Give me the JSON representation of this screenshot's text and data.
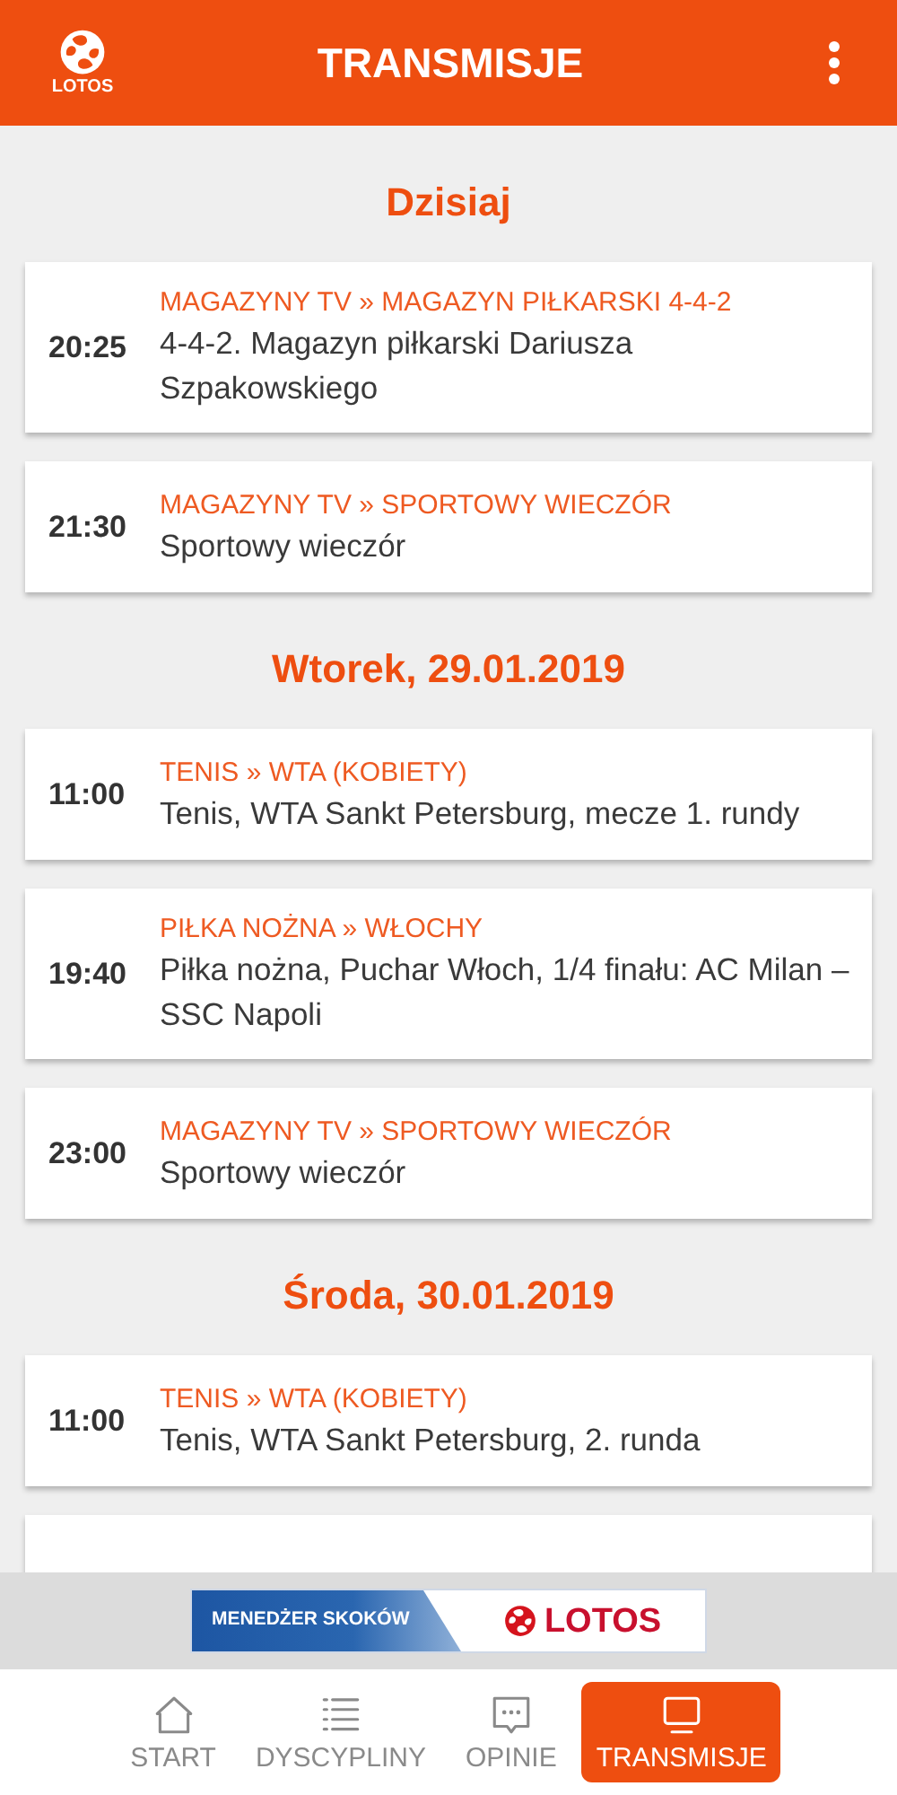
{
  "header": {
    "logo_text": "LOTOS",
    "title": "TRANSMISJE"
  },
  "days": [
    {
      "heading": "Dzisiaj",
      "items": [
        {
          "time": "20:25",
          "category": "MAGAZYNY TV » MAGAZYN PIŁKARSKI 4-4-2",
          "title": "4-4-2. Magazyn piłkarski Dariusza Szpakowskiego"
        },
        {
          "time": "21:30",
          "category": "MAGAZYNY TV » SPORTOWY WIECZÓR",
          "title": "Sportowy wieczór"
        }
      ]
    },
    {
      "heading": "Wtorek, 29.01.2019",
      "items": [
        {
          "time": "11:00",
          "category": "TENIS » WTA (KOBIETY)",
          "title": "Tenis, WTA Sankt Petersburg, mecze 1. rundy"
        },
        {
          "time": "19:40",
          "category": "PIŁKA NOŻNA » WŁOCHY",
          "title": "Piłka nożna, Puchar Włoch, 1/4 finału: AC Milan – SSC Napoli"
        },
        {
          "time": "23:00",
          "category": "MAGAZYNY TV » SPORTOWY WIECZÓR",
          "title": "Sportowy wieczór"
        }
      ]
    },
    {
      "heading": "Środa, 30.01.2019",
      "items": [
        {
          "time": "11:00",
          "category": "TENIS » WTA (KOBIETY)",
          "title": "Tenis, WTA Sankt Petersburg, 2. runda"
        }
      ]
    }
  ],
  "banner": {
    "text": "MENEDŻER SKOKÓW",
    "brand": "LOTOS"
  },
  "nav": [
    {
      "kind": "home",
      "label": "START",
      "selected": false
    },
    {
      "kind": "list",
      "label": "DYSCYPLINY",
      "selected": false
    },
    {
      "kind": "chat",
      "label": "OPINIE",
      "selected": false
    },
    {
      "kind": "tv",
      "label": "TRANSMISJE",
      "selected": true
    }
  ]
}
